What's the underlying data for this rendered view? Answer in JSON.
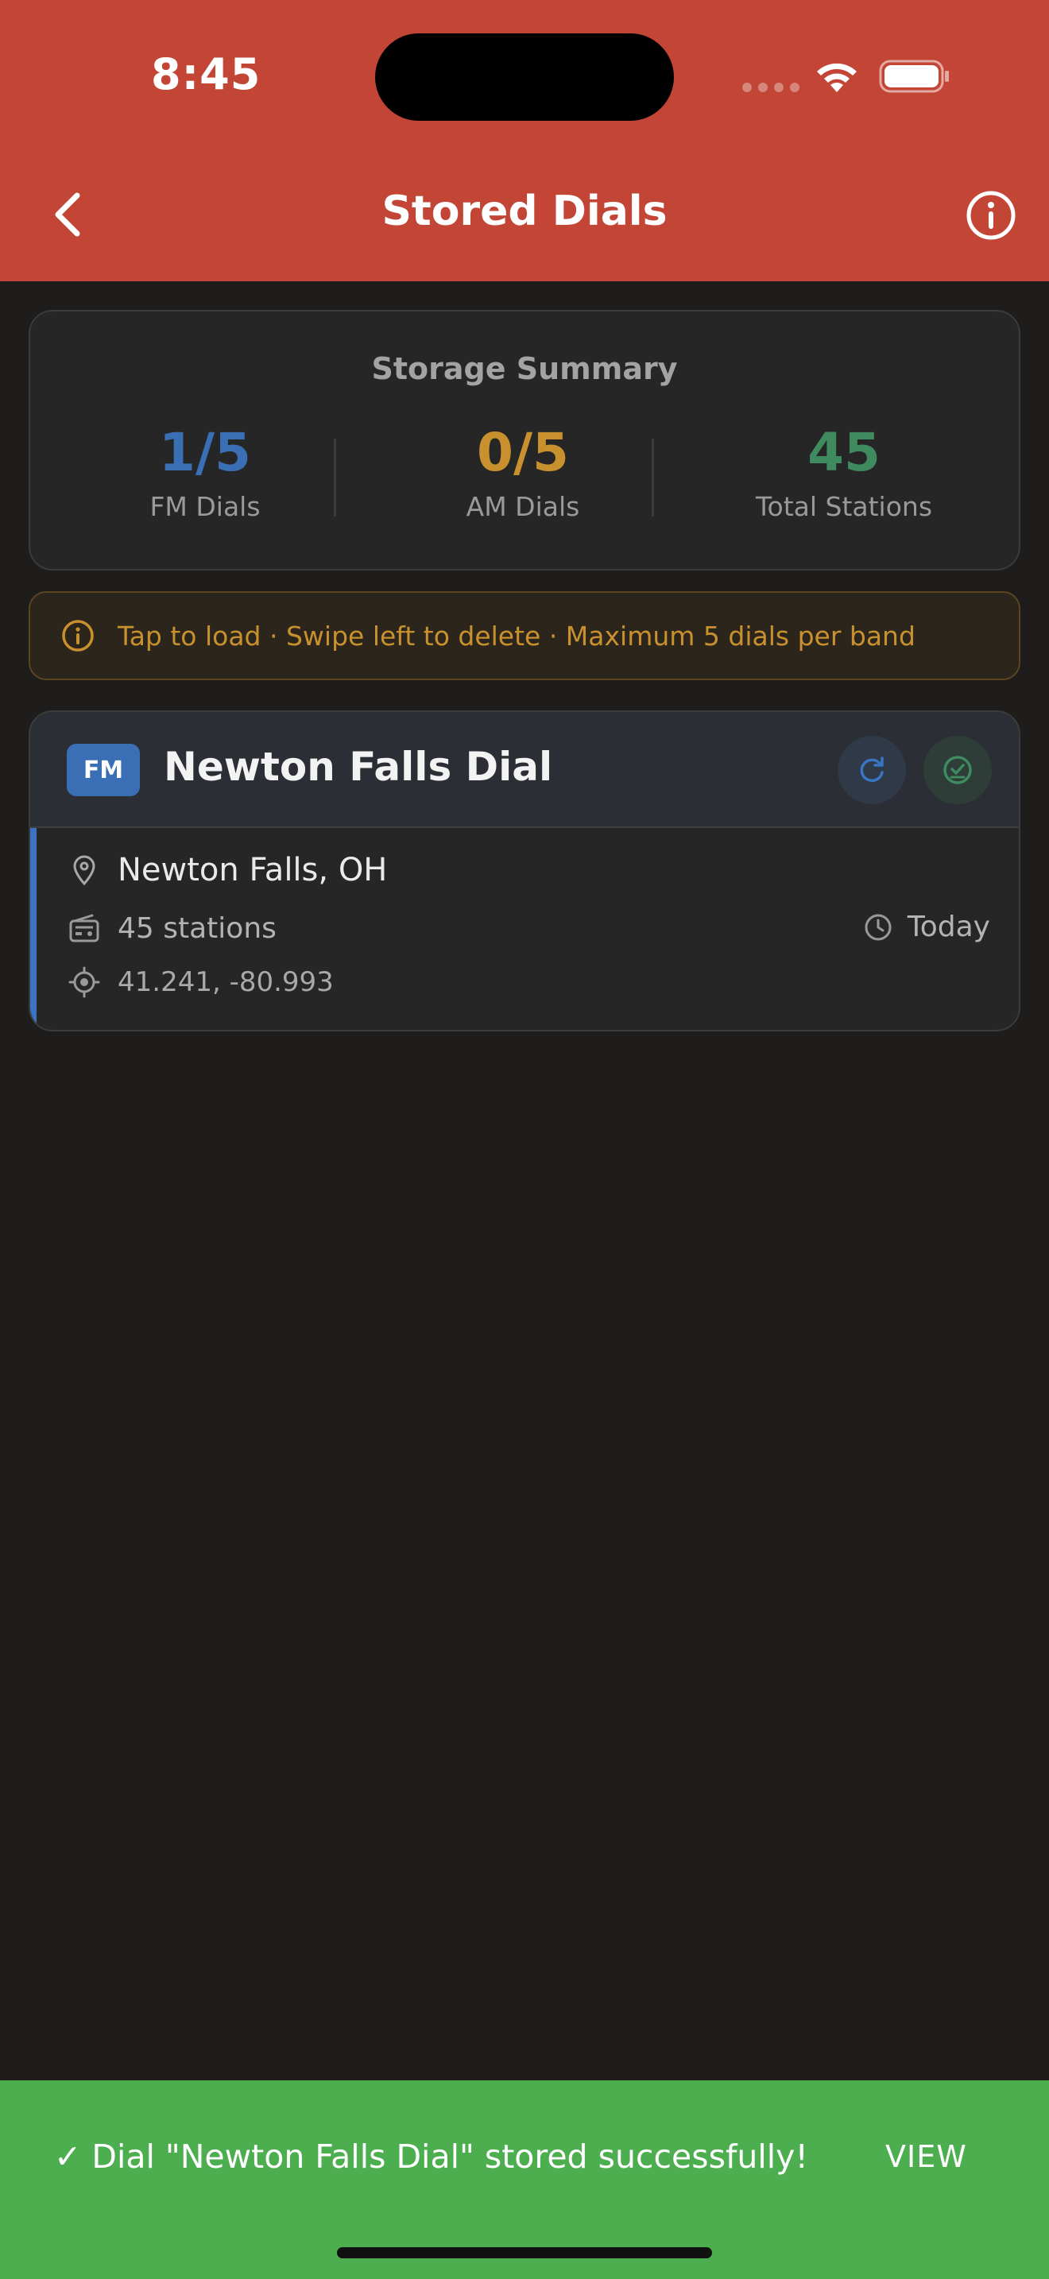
{
  "status_bar": {
    "time": "8:45"
  },
  "header": {
    "title": "Stored Dials"
  },
  "summary": {
    "title": "Storage Summary",
    "stats": [
      {
        "value": "1/5",
        "label": "FM Dials",
        "color": "#3a6fb5"
      },
      {
        "value": "0/5",
        "label": "AM Dials",
        "color": "#c9912e"
      },
      {
        "value": "45",
        "label": "Total Stations",
        "color": "#3f8a5f"
      }
    ]
  },
  "hint": {
    "text": "Tap to load · Swipe left to delete · Maximum 5 dials per band"
  },
  "dials": [
    {
      "band": "FM",
      "name": "Newton Falls Dial",
      "location": "Newton Falls, OH",
      "stations": "45 stations",
      "updated": "Today",
      "coordinates": "41.241, -80.993"
    }
  ],
  "toast": {
    "message": "✓ Dial \"Newton Falls Dial\" stored successfully!",
    "action": "VIEW"
  },
  "colors": {
    "header": "#c24535",
    "background": "#1e1d1c",
    "fm_accent": "#3a6fb5",
    "am_accent": "#c9912e",
    "success": "#4cae4f"
  },
  "icons": [
    "back-chevron-icon",
    "info-icon",
    "refresh-icon",
    "check-circle-icon",
    "location-pin-icon",
    "radio-icon",
    "clock-icon",
    "crosshair-icon",
    "wifi-icon",
    "battery-icon"
  ]
}
